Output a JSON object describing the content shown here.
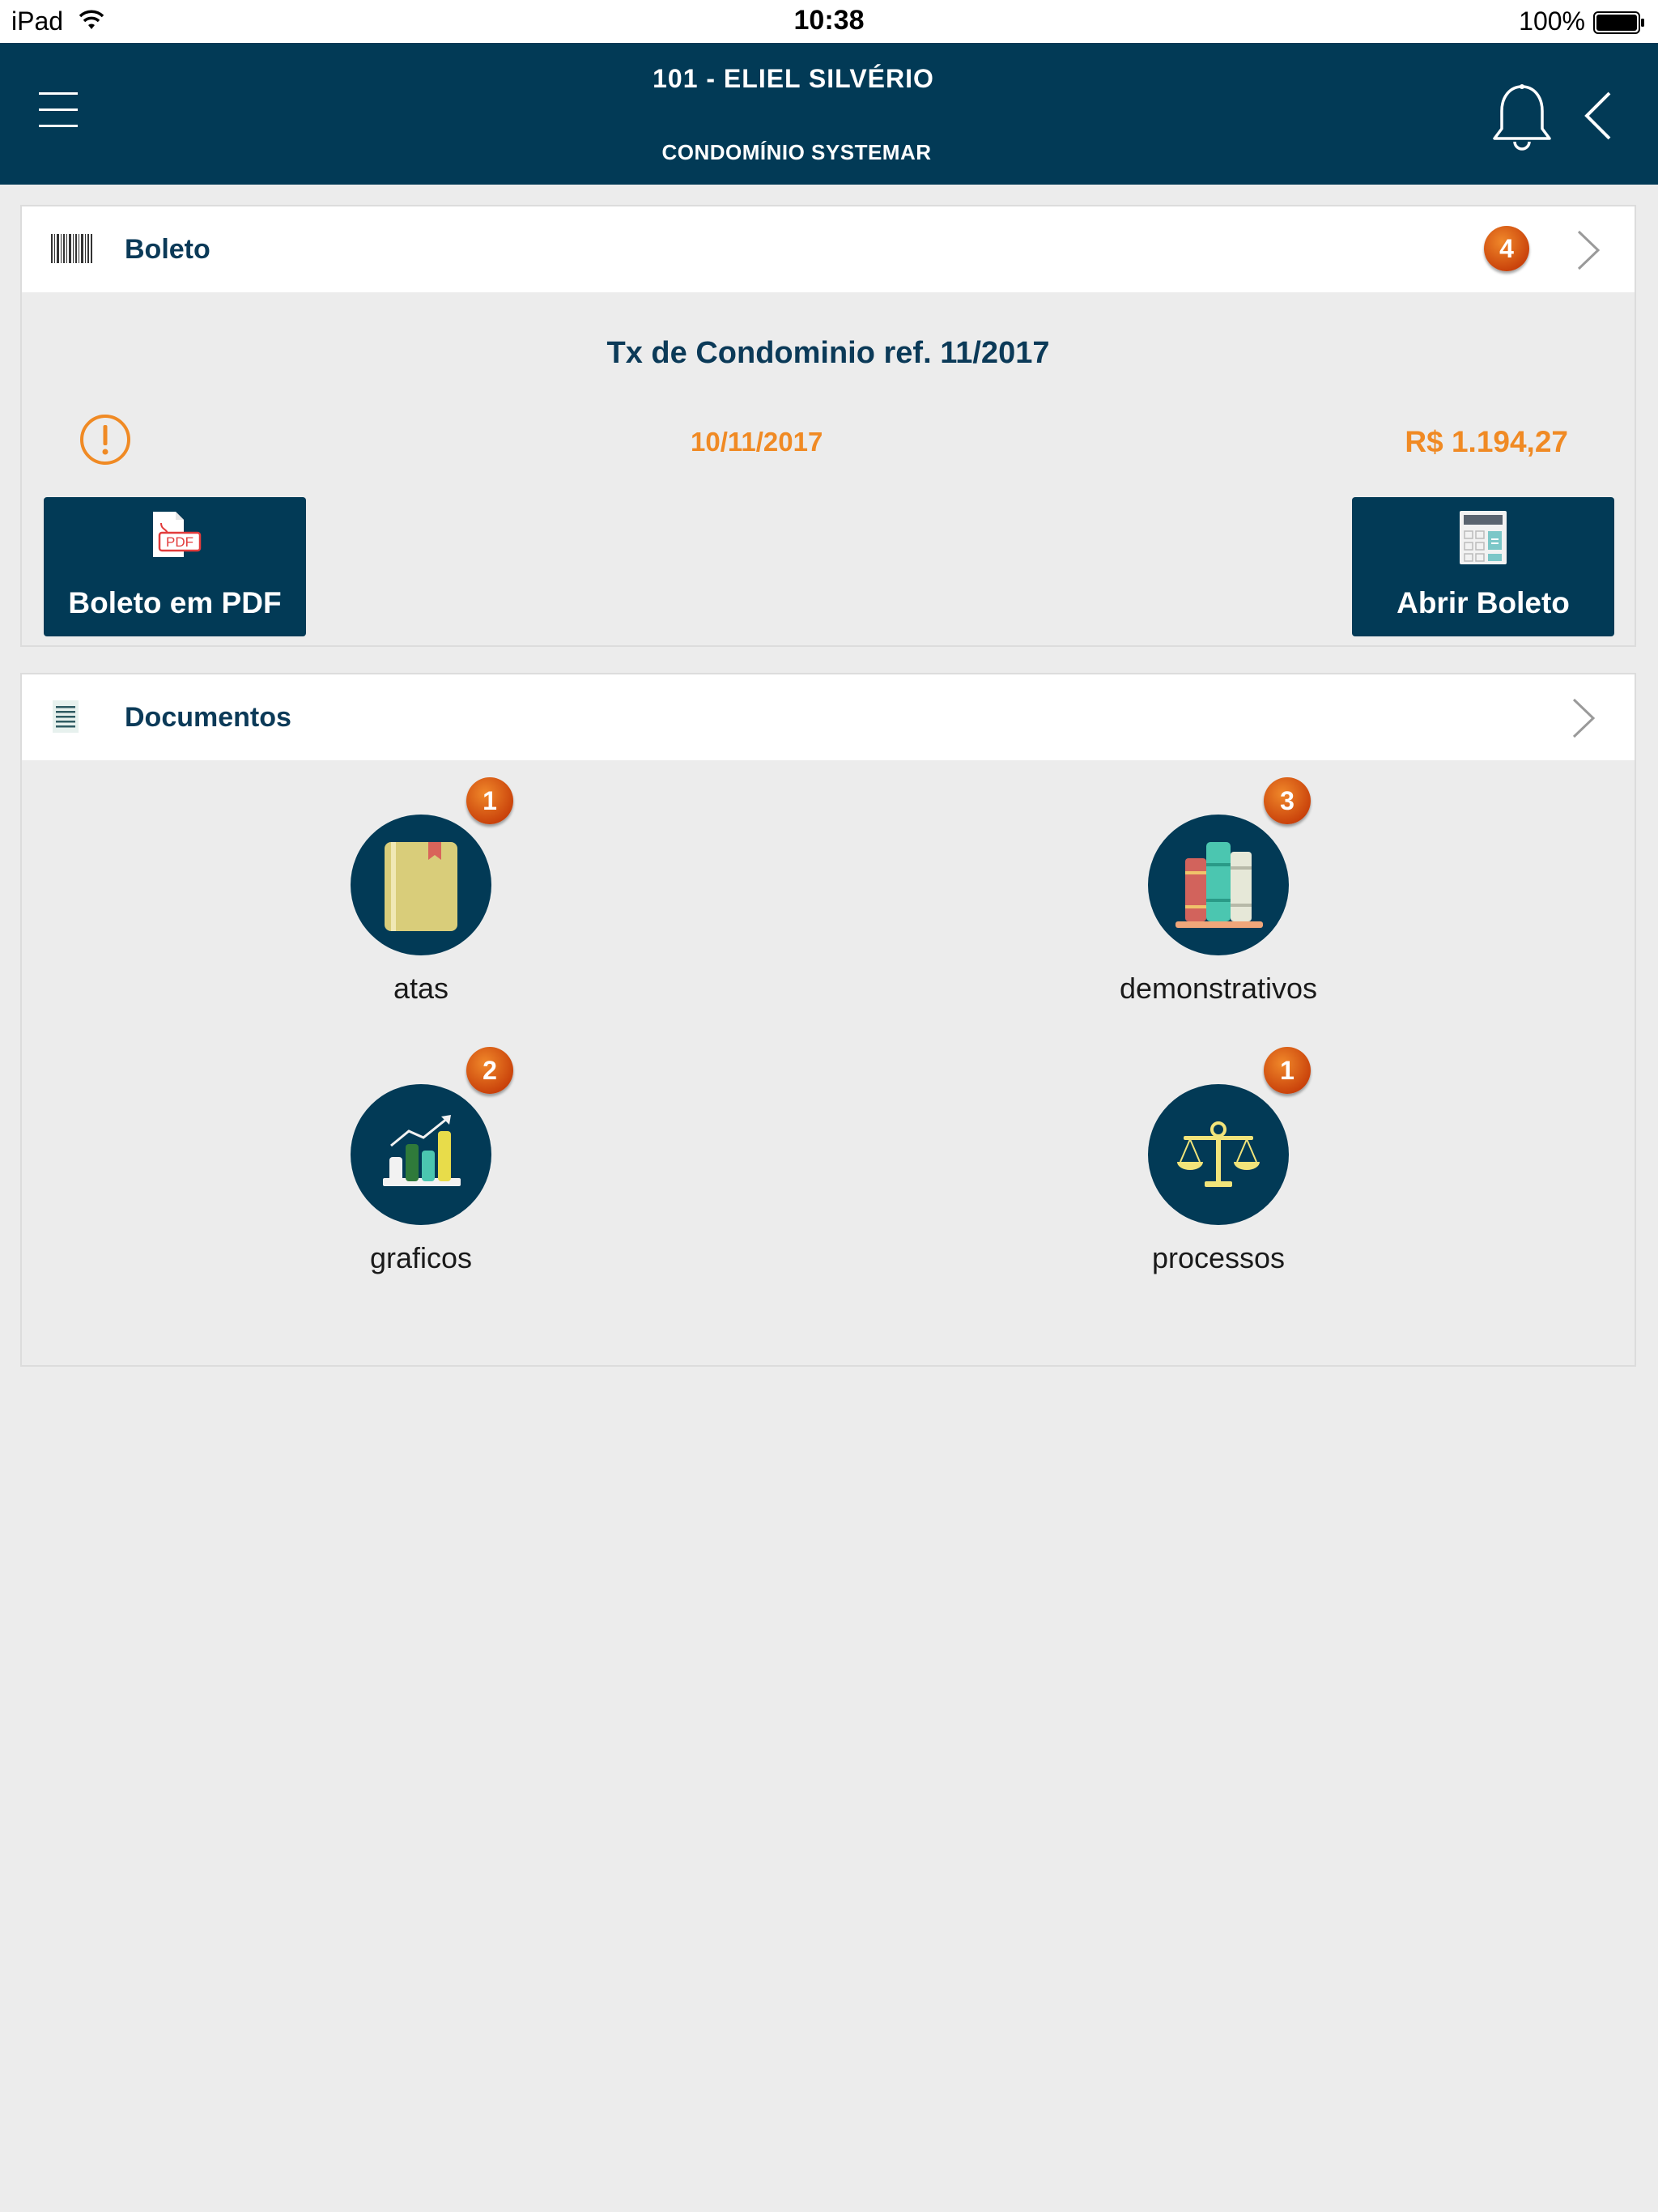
{
  "status_bar": {
    "device": "iPad",
    "time": "10:38",
    "battery": "100%"
  },
  "header": {
    "title": "101 - ELIEL SILVÉRIO",
    "subtitle": "CONDOMÍNIO SYSTEMAR"
  },
  "boleto": {
    "section_title": "Boleto",
    "badge": "4",
    "description": "Tx de Condominio ref. 11/2017",
    "due_date": "10/11/2017",
    "amount": "R$ 1.194,27",
    "pdf_button_label": "Boleto em PDF",
    "pdf_icon_text": "PDF",
    "open_button_label": "Abrir Boleto",
    "accent_color": "#f08a24"
  },
  "documentos": {
    "section_title": "Documentos",
    "items": [
      {
        "label": "atas",
        "badge": "1",
        "icon": "book-icon"
      },
      {
        "label": "demonstrativos",
        "badge": "3",
        "icon": "books-icon"
      },
      {
        "label": "graficos",
        "badge": "2",
        "icon": "bar-chart-icon"
      },
      {
        "label": "processos",
        "badge": "1",
        "icon": "scale-icon"
      }
    ]
  },
  "colors": {
    "primary": "#023a56",
    "background": "#ececec",
    "badge": "#d9541a"
  }
}
